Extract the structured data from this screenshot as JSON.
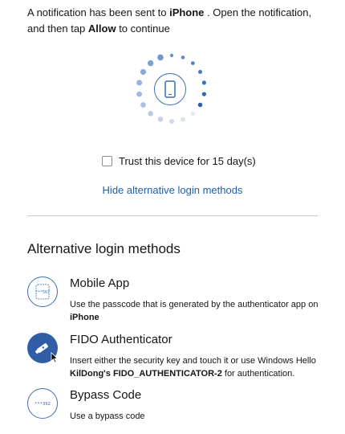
{
  "notice": {
    "part1": "A notification has been sent to ",
    "device": "iPhone",
    "part2": " . Open the notification, and then tap ",
    "action": "Allow",
    "part3": " to continue"
  },
  "trust": {
    "label": "Trust this device for 15 day(s)",
    "checked": false
  },
  "hide_link": "Hide alternative login methods",
  "alt": {
    "title": "Alternative login methods",
    "methods": [
      {
        "title": "Mobile App",
        "desc_pre": "Use the passcode that is generated by the authenticator app on ",
        "desc_bold": "iPhone",
        "desc_post": "",
        "icon": "mobile-app-passcode-icon",
        "icon_text": "***567"
      },
      {
        "title": "FIDO Authenticator",
        "desc_pre": "Insert either the security key and touch it or use Windows Hello ",
        "desc_bold": "KilDong's FIDO_AUTHENTICATOR-2",
        "desc_post": " for authentication.",
        "icon": "security-key-icon"
      },
      {
        "title": "Bypass Code",
        "desc_pre": "Use a bypass code",
        "desc_bold": "",
        "desc_post": "",
        "icon": "bypass-code-icon",
        "icon_text": "***392"
      }
    ]
  },
  "colors": {
    "accent": "#3a6fb7",
    "link": "#1f5fa8",
    "filled_icon": "#2f5ea7"
  }
}
